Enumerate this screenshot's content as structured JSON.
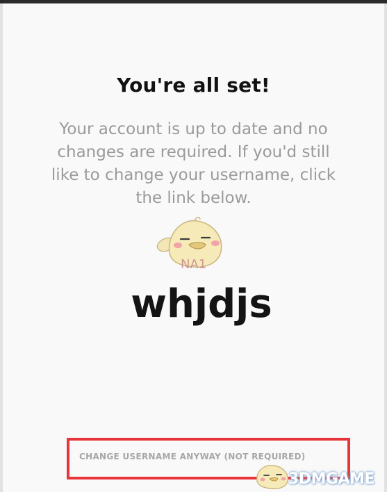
{
  "dialog": {
    "title": "You're all set!",
    "message": "Your account is up to date and no changes are required. If you'd still like to change your username, click the link below.",
    "region": "NA1",
    "username": "whjdjs",
    "change_link": "CHANGE USERNAME ANYWAY (NOT REQUIRED)"
  },
  "watermark": {
    "text": "3DMGAME"
  },
  "colors": {
    "highlight_border": "#e8353a",
    "title": "#111111",
    "message": "#9a9a9a",
    "link": "#a7a7a7"
  },
  "icons": {
    "mascot": "chick-mascot-icon"
  }
}
